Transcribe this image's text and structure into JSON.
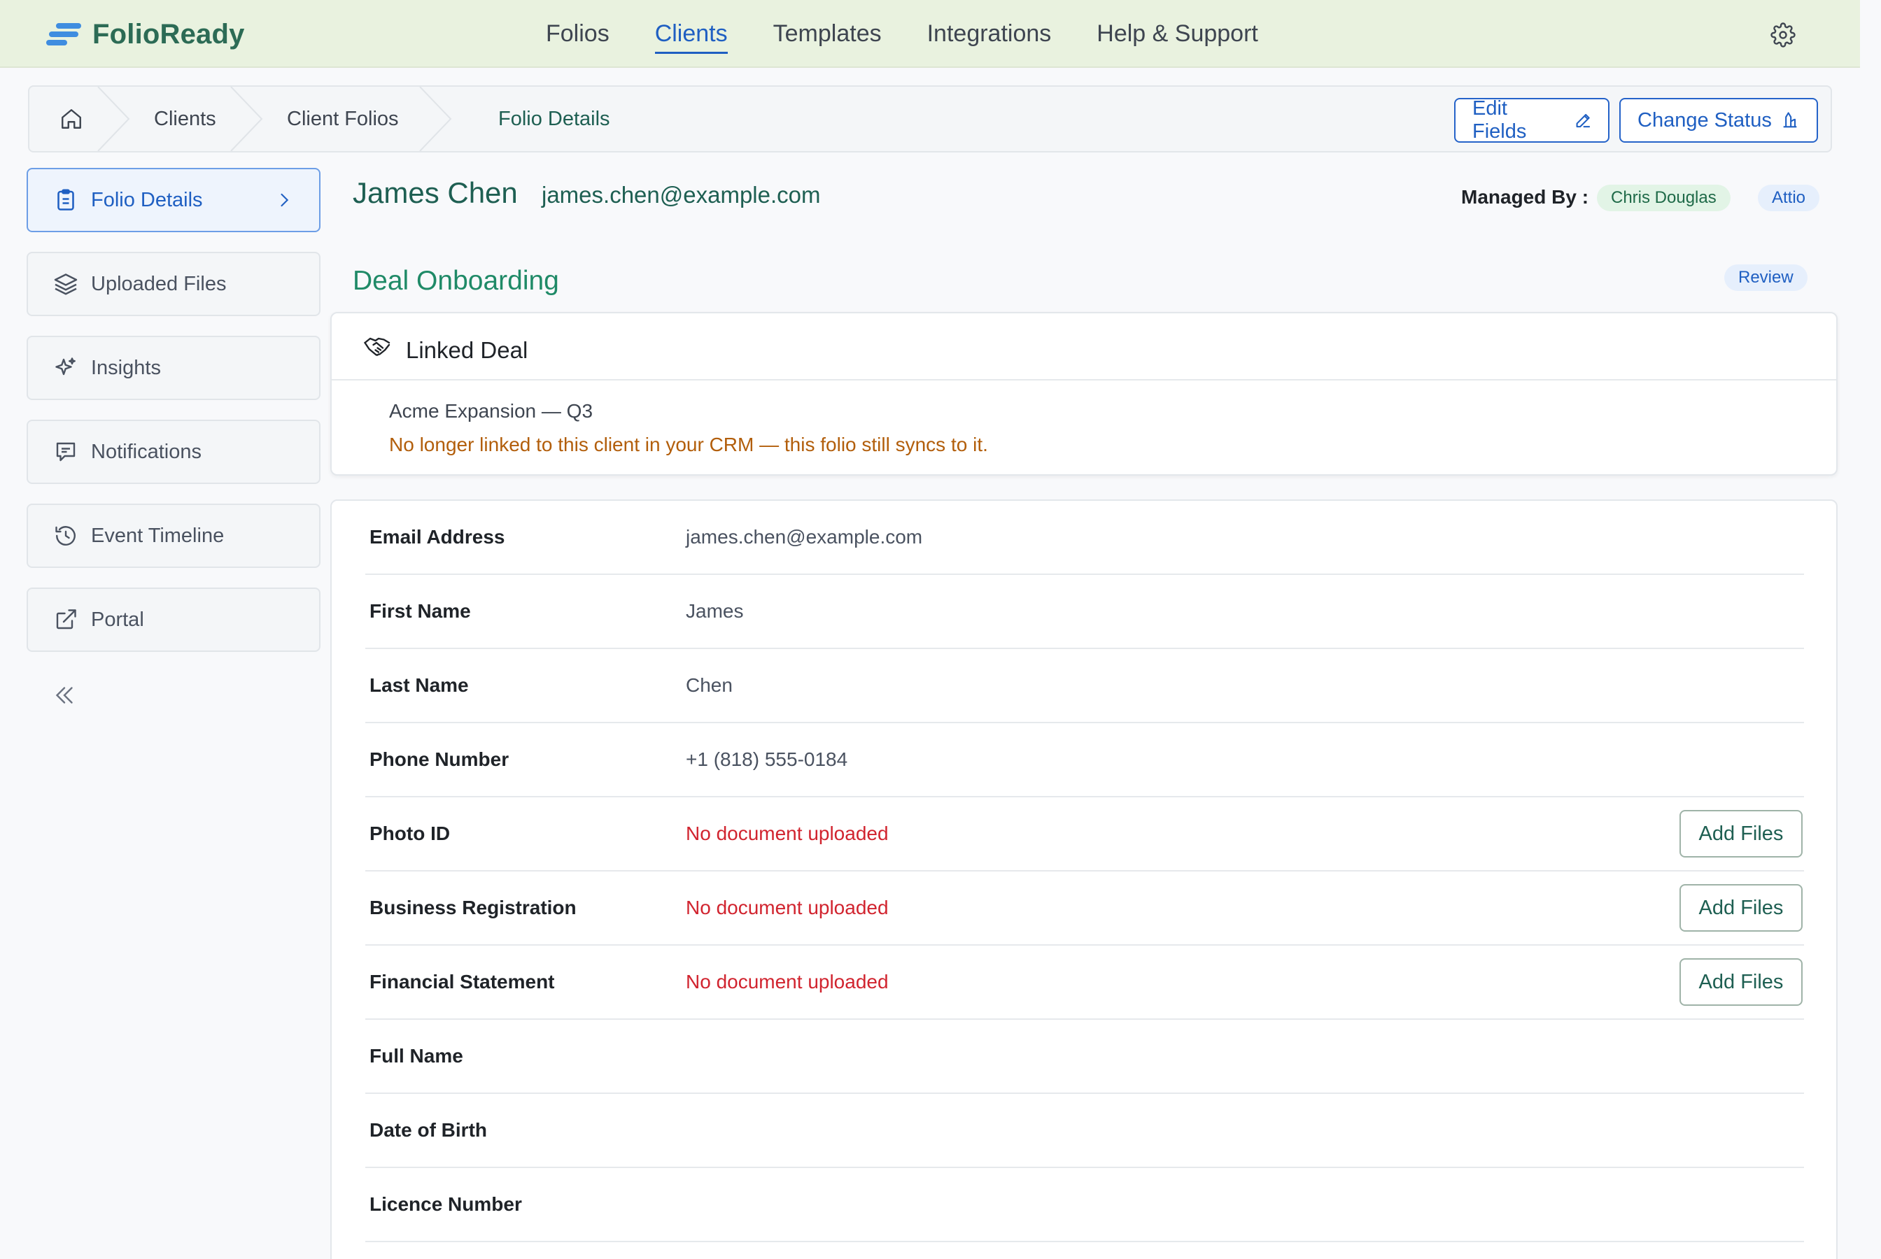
{
  "brand": {
    "name": "FolioReady"
  },
  "nav": {
    "links": [
      {
        "label": "Folios",
        "active": false
      },
      {
        "label": "Clients",
        "active": true
      },
      {
        "label": "Templates",
        "active": false
      },
      {
        "label": "Integrations",
        "active": false
      },
      {
        "label": "Help & Support",
        "active": false
      }
    ],
    "settings_icon": "gear-icon"
  },
  "breadcrumb": {
    "home_icon": "home-icon",
    "items": [
      "Clients",
      "Client Folios",
      "Folio Details"
    ]
  },
  "actions": {
    "edit_fields": "Edit Fields",
    "change_status": "Change Status"
  },
  "sidebar": {
    "items": [
      {
        "label": "Folio Details",
        "icon": "clipboard-icon",
        "active": true
      },
      {
        "label": "Uploaded Files",
        "icon": "layers-icon",
        "active": false
      },
      {
        "label": "Insights",
        "icon": "sparkle-icon",
        "active": false
      },
      {
        "label": "Notifications",
        "icon": "message-icon",
        "active": false
      },
      {
        "label": "Event Timeline",
        "icon": "history-icon",
        "active": false
      },
      {
        "label": "Portal",
        "icon": "external-link-icon",
        "active": false
      }
    ],
    "collapse_icon": "double-chevron-left-icon"
  },
  "client": {
    "name": "James Chen",
    "email": "james.chen@example.com",
    "managed_by_label": "Managed By :",
    "manager": "Chris Douglas",
    "crm": "Attio"
  },
  "section": {
    "title": "Deal Onboarding",
    "status": "Review"
  },
  "linked_deal": {
    "title": "Linked Deal",
    "icon": "handshake-icon",
    "deal_name": "Acme Expansion — Q3",
    "warning": "No longer linked to this client in your CRM — this folio still syncs to it."
  },
  "fields": [
    {
      "label": "Email Address",
      "value": "james.chen@example.com",
      "missing": false
    },
    {
      "label": "First Name",
      "value": "James",
      "missing": false
    },
    {
      "label": "Last Name",
      "value": "Chen",
      "missing": false
    },
    {
      "label": "Phone Number",
      "value": "+1 (818) 555-0184",
      "missing": false
    },
    {
      "label": "Photo ID",
      "value": "No document uploaded",
      "missing": true,
      "action": "Add Files"
    },
    {
      "label": "Business Registration",
      "value": "No document uploaded",
      "missing": true,
      "action": "Add Files"
    },
    {
      "label": "Financial Statement",
      "value": "No document uploaded",
      "missing": true,
      "action": "Add Files"
    },
    {
      "label": "Full Name",
      "value": "",
      "missing": false
    },
    {
      "label": "Date of Birth",
      "value": "",
      "missing": false
    },
    {
      "label": "Licence Number",
      "value": "",
      "missing": false
    }
  ],
  "colors": {
    "accent_blue": "#1f5fc2",
    "brand_green": "#1e5f52",
    "section_green": "#1f8a67",
    "warning_orange": "#b25e0b",
    "missing_red": "#d1242f",
    "nav_bg": "#e9f2df"
  }
}
